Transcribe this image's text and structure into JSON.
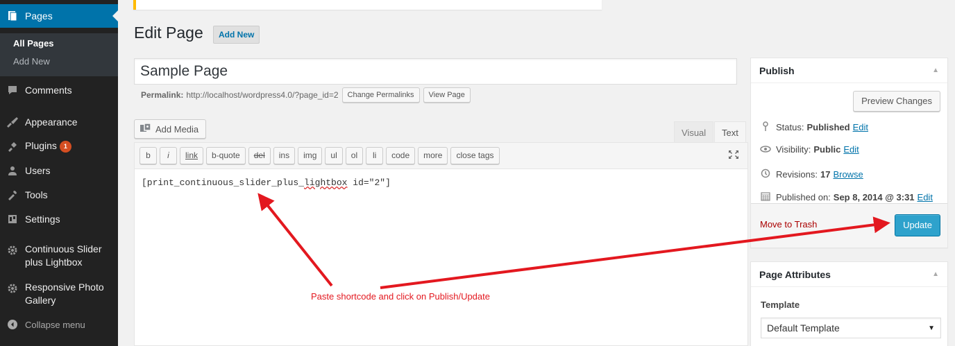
{
  "sidebar": {
    "pages_label": "Pages",
    "submenu": {
      "all_pages": "All Pages",
      "add_new": "Add New"
    },
    "comments": "Comments",
    "appearance": "Appearance",
    "plugins": "Plugins",
    "plugins_badge": "1",
    "users": "Users",
    "tools": "Tools",
    "settings": "Settings",
    "continuous_slider_line1": "Continuous Slider",
    "continuous_slider_line2": "plus Lightbox",
    "responsive_gallery_line1": "Responsive Photo",
    "responsive_gallery_line2": "Gallery",
    "collapse": "Collapse menu"
  },
  "header": {
    "title": "Edit Page",
    "add_new": "Add New"
  },
  "editor": {
    "title_value": "Sample Page",
    "permalink_label": "Permalink:",
    "permalink_url": "http://localhost/wordpress4.0/?page_id=2",
    "change_permalinks": "Change Permalinks",
    "view_page": "View Page",
    "add_media": "Add Media",
    "tabs": {
      "visual": "Visual",
      "text": "Text"
    },
    "quicktags": [
      "b",
      "i",
      "link",
      "b-quote",
      "del",
      "ins",
      "img",
      "ul",
      "ol",
      "li",
      "code",
      "more",
      "close tags"
    ],
    "content_part1": "[print_continuous_slider_plus_",
    "content_spell": "lightbox",
    "content_part2": " id=\"2\"]"
  },
  "annotation": {
    "text": "Paste shortcode and click on Publish/Update",
    "color": "#e3181f"
  },
  "publish": {
    "title": "Publish",
    "preview": "Preview Changes",
    "status_label": "Status:",
    "status_value": "Published",
    "visibility_label": "Visibility:",
    "visibility_value": "Public",
    "revisions_label": "Revisions:",
    "revisions_value": "17",
    "published_label": "Published on:",
    "published_value": "Sep 8, 2014 @ 3:31",
    "edit": "Edit",
    "browse": "Browse",
    "trash": "Move to Trash",
    "update": "Update"
  },
  "attributes": {
    "title": "Page Attributes",
    "template_label": "Template",
    "template_value": "Default Template"
  },
  "colors": {
    "accent": "#0073aa",
    "update_button": "#2ea2cc",
    "sidebar_bg": "#222222",
    "trash": "#aa0000"
  }
}
